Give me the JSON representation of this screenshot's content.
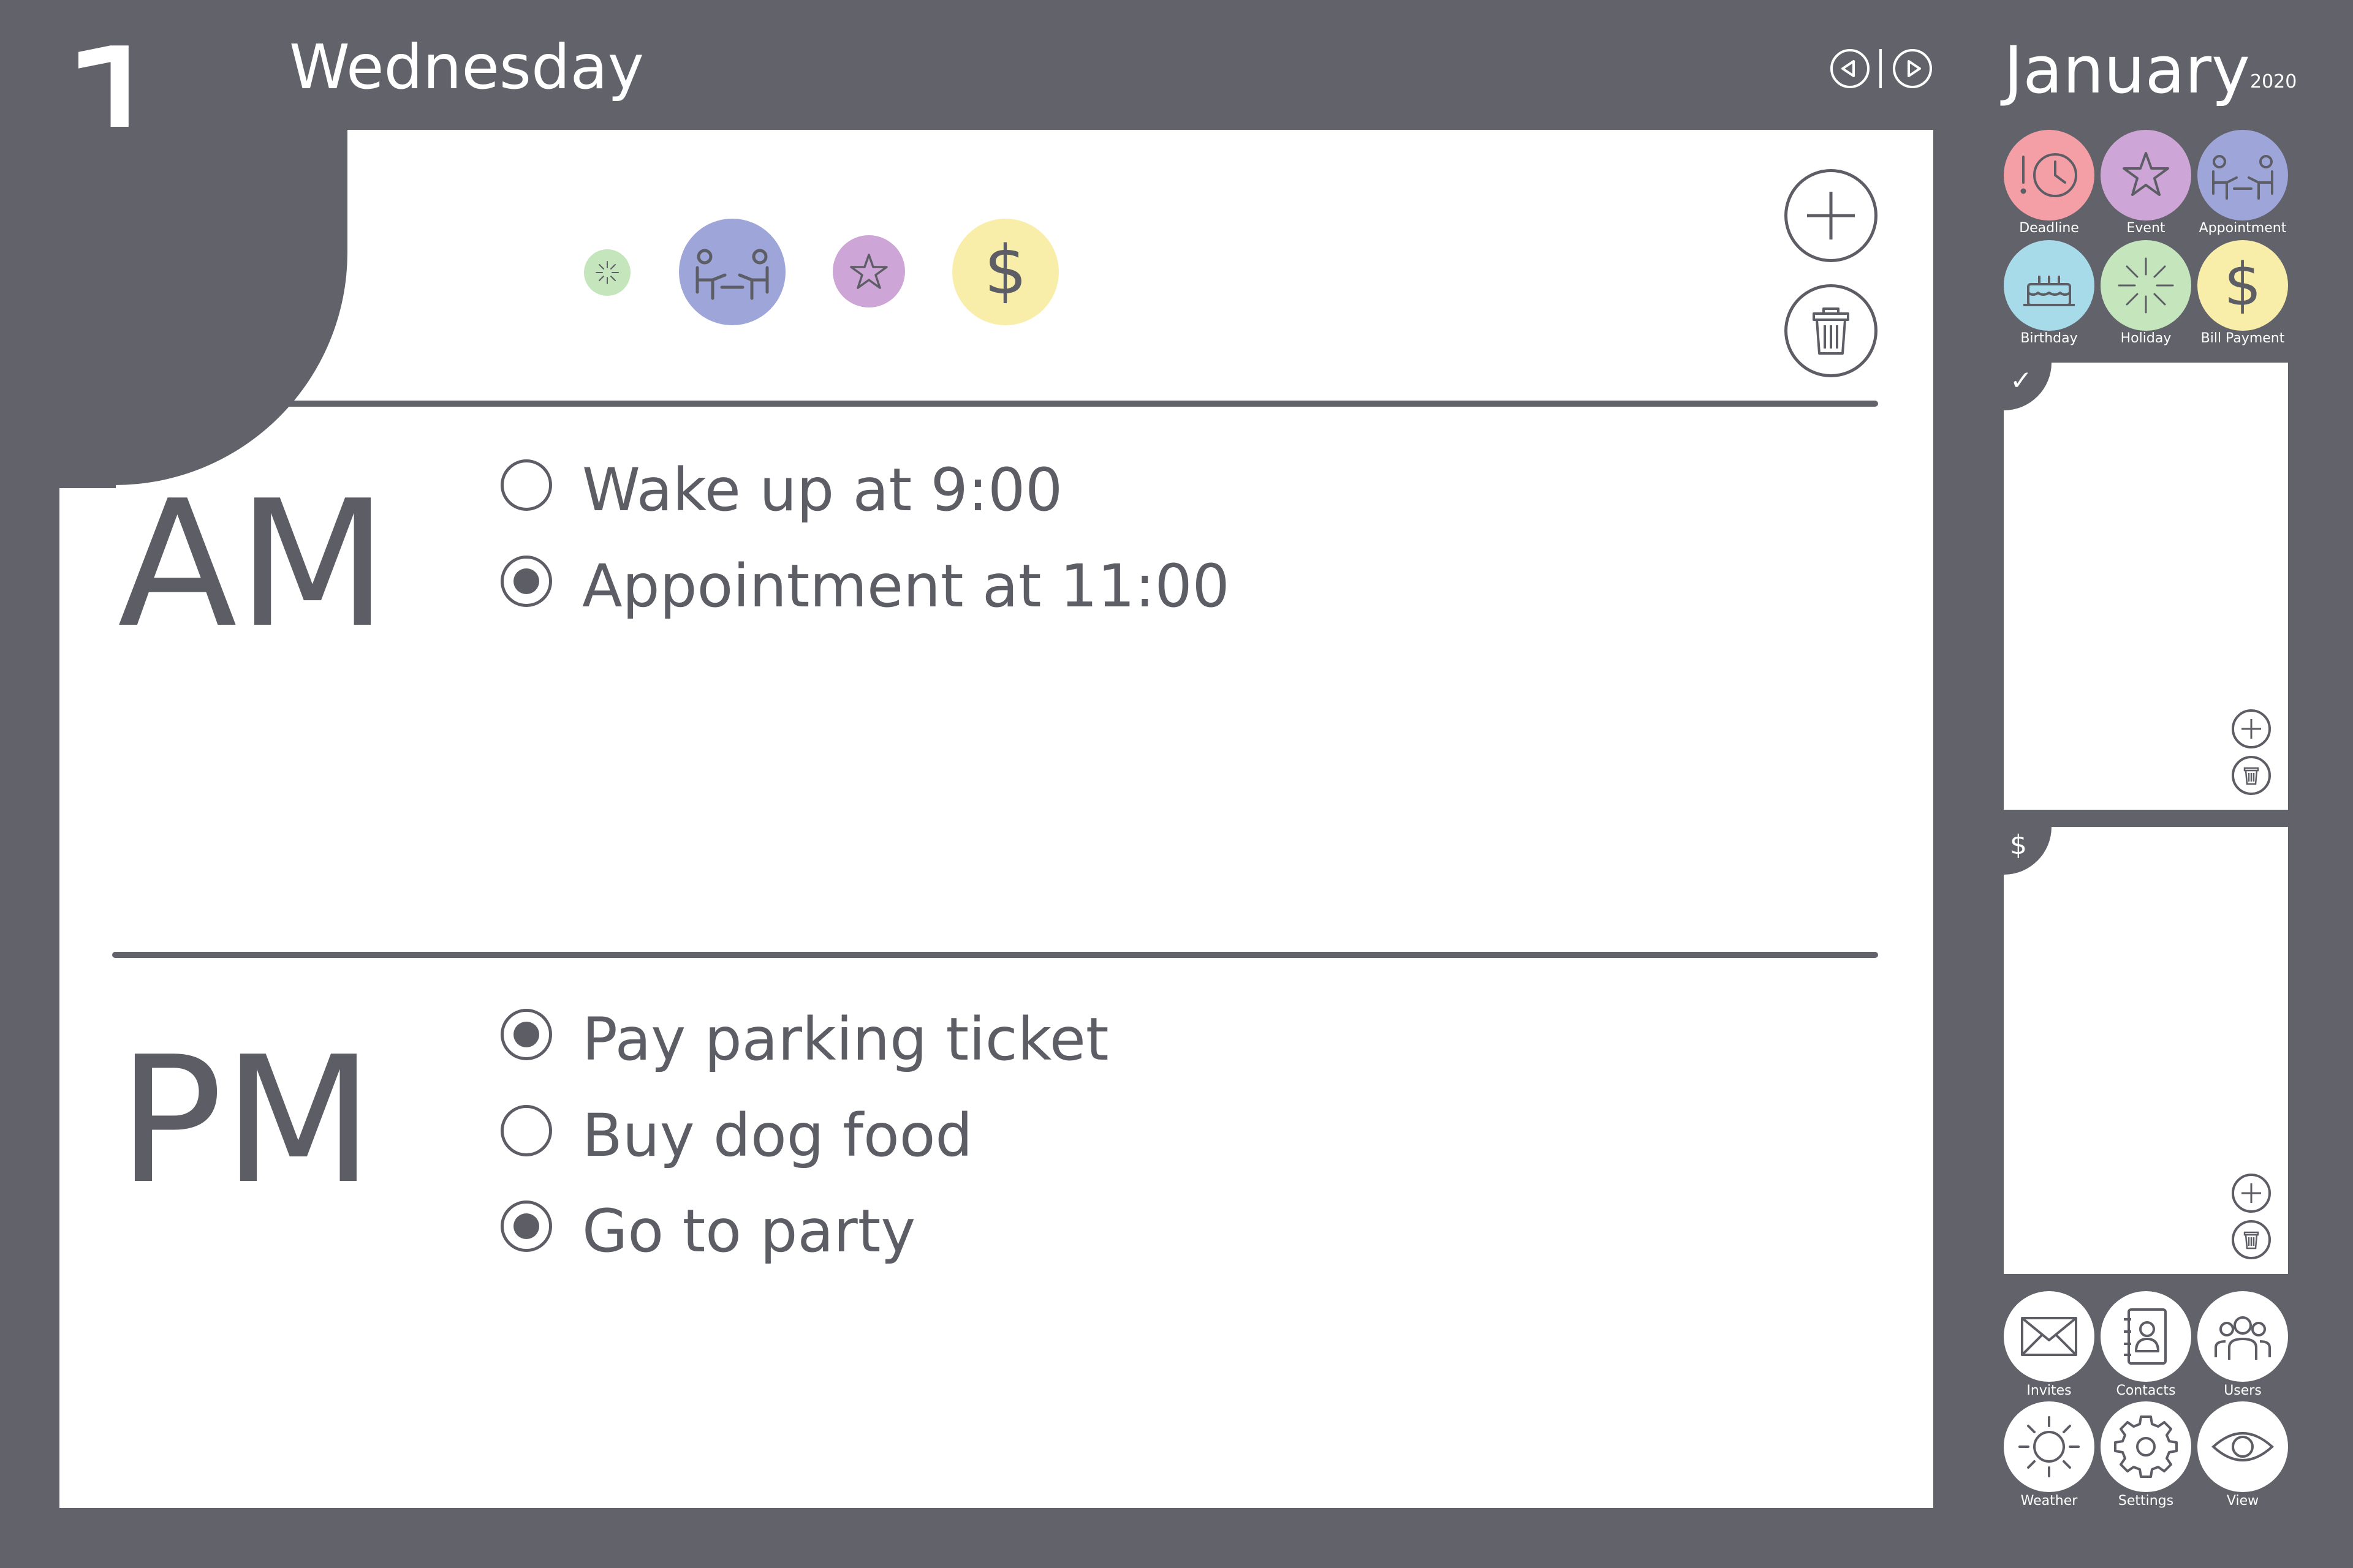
{
  "header": {
    "day_number": "1",
    "weekday": "Wednesday",
    "month": "January",
    "year": "2020",
    "prev_icon": "triangle-left-circle-icon",
    "next_icon": "triangle-right-circle-icon"
  },
  "day_categories": [
    {
      "name": "holiday",
      "icon": "fireworks-icon",
      "color": "#c5e5bd"
    },
    {
      "name": "appointment",
      "icon": "meeting-icon",
      "color": "#9ea5d9"
    },
    {
      "name": "event",
      "icon": "star-icon",
      "color": "#cda5d6"
    },
    {
      "name": "bill-payment",
      "icon": "dollar-icon",
      "color": "#f8eeaa"
    }
  ],
  "actions": {
    "add_icon": "plus-icon",
    "delete_icon": "trash-icon"
  },
  "am": {
    "label": "AM",
    "tasks": [
      {
        "text": "Wake up at 9:00",
        "checked": false
      },
      {
        "text": "Appointment at 11:00",
        "checked": true
      }
    ]
  },
  "pm": {
    "label": "PM",
    "tasks": [
      {
        "text": "Pay parking ticket",
        "checked": true
      },
      {
        "text": "Buy dog food",
        "checked": false
      },
      {
        "text": "Go to party",
        "checked": true
      }
    ]
  },
  "legend": [
    {
      "label": "Deadline",
      "icon": "clock-alert-icon",
      "color": "#f49ea6"
    },
    {
      "label": "Event",
      "icon": "star-icon",
      "color": "#cda5d6"
    },
    {
      "label": "Appointment",
      "icon": "meeting-icon",
      "color": "#9ea5d9"
    },
    {
      "label": "Birthday",
      "icon": "cake-icon",
      "color": "#a8dbe9"
    },
    {
      "label": "Holiday",
      "icon": "fireworks-icon",
      "color": "#c5e5bd"
    },
    {
      "label": "Bill Payment",
      "icon": "dollar-icon",
      "color": "#f8eeaa"
    }
  ],
  "side_panels": [
    {
      "tab_symbol": "✓",
      "icon": "checkmark-icon"
    },
    {
      "tab_symbol": "$",
      "icon": "dollar-icon"
    }
  ],
  "apps": [
    {
      "label": "Invites",
      "icon": "envelope-icon"
    },
    {
      "label": "Contacts",
      "icon": "contacts-book-icon"
    },
    {
      "label": "Users",
      "icon": "users-icon"
    },
    {
      "label": "Weather",
      "icon": "sun-icon"
    },
    {
      "label": "Settings",
      "icon": "gear-icon"
    },
    {
      "label": "View",
      "icon": "eye-icon"
    }
  ],
  "colors": {
    "background": "#62626b",
    "panel": "#ffffff",
    "text": "#5d5d66"
  }
}
